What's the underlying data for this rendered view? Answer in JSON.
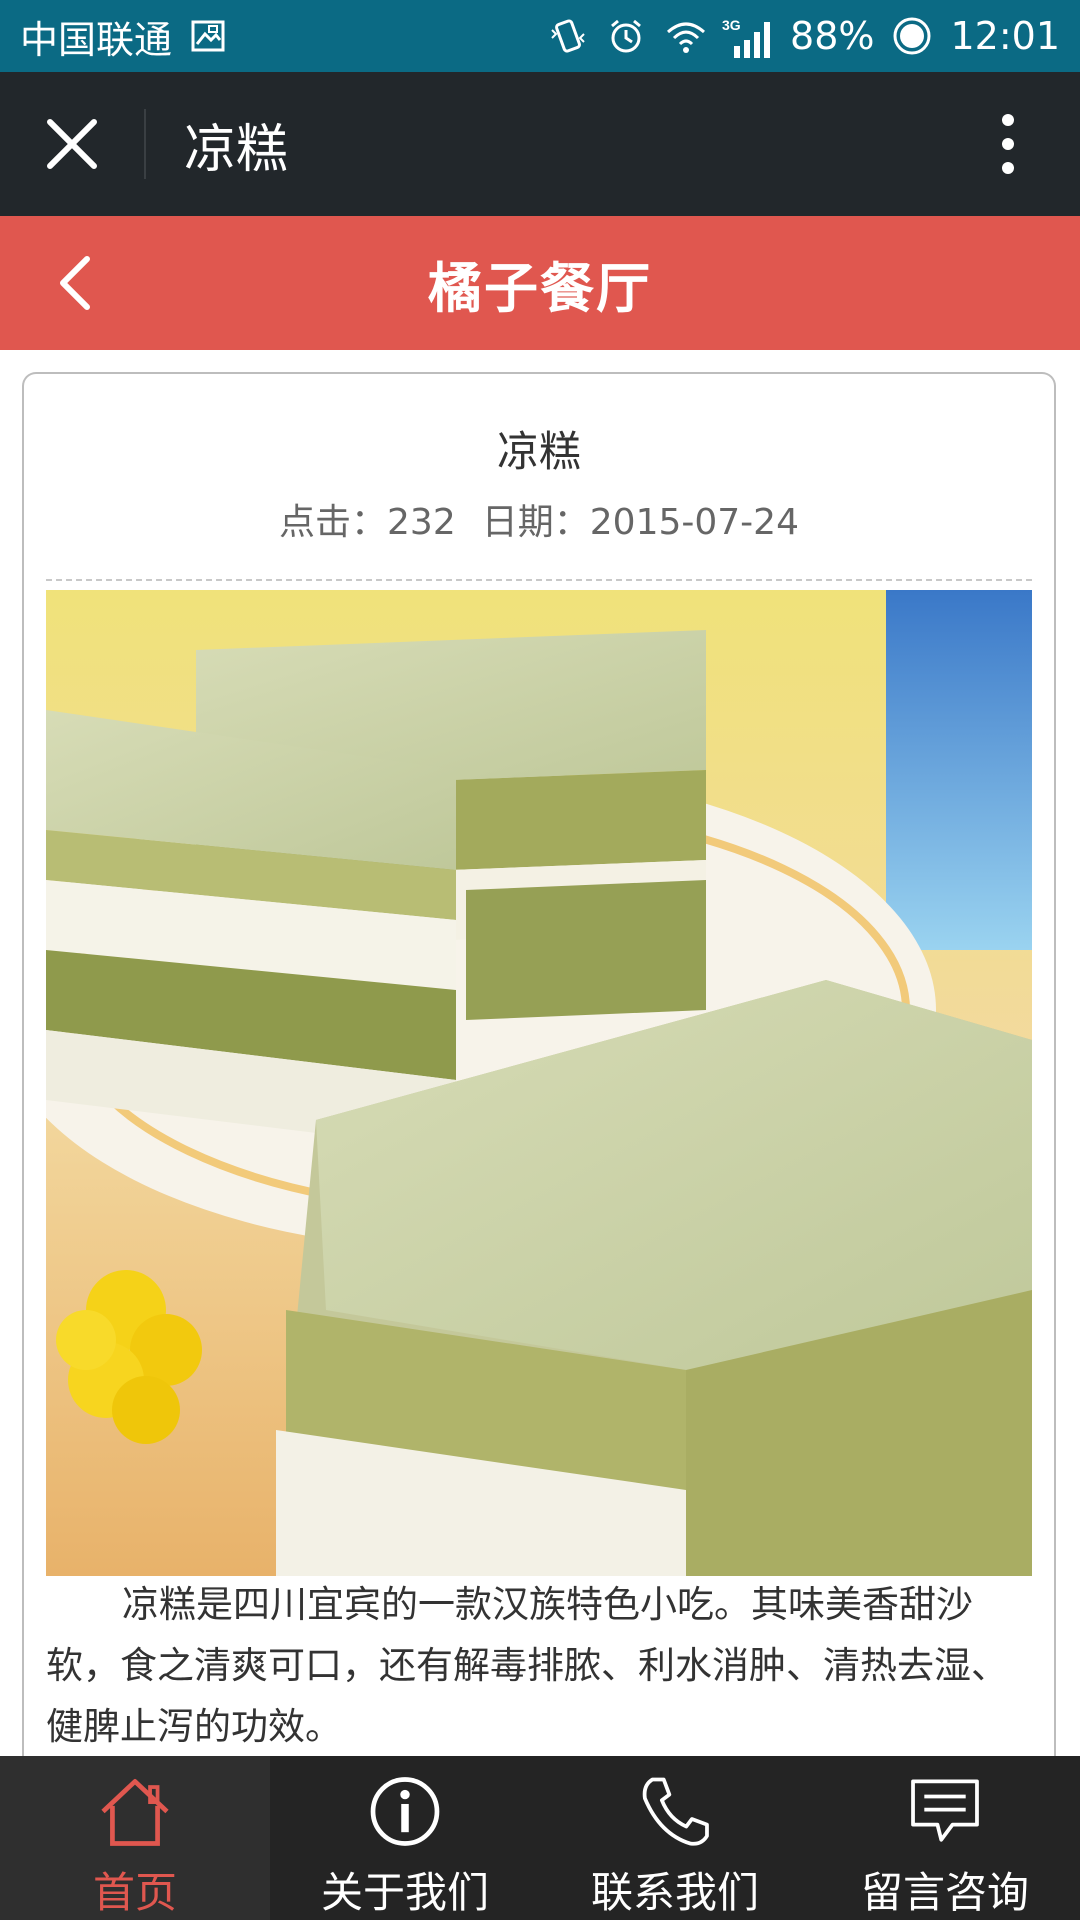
{
  "status_bar": {
    "carrier": "中国联通",
    "network": "3G",
    "battery": "88%",
    "time": "12:01",
    "icons": [
      "image-icon",
      "vibrate-icon",
      "alarm-icon",
      "wifi-icon",
      "signal-icon",
      "battery-icon"
    ]
  },
  "top_bar": {
    "title": "凉糕",
    "close_icon": "close-icon",
    "more_icon": "more-vertical-icon"
  },
  "site_header": {
    "title": "橘子餐厅",
    "back_icon": "chevron-left-icon"
  },
  "article": {
    "title": "凉糕",
    "clicks_label": "点击：",
    "clicks_value": "232",
    "date_label": "日期：",
    "date_value": "2015-07-24",
    "body": "凉糕是四川宜宾的一款汉族特色小吃。其味美香甜沙软，食之清爽可口，还有解毒排脓、利水消肿、清热去湿、健脾止泻的功效。"
  },
  "bottom_nav": {
    "items": [
      {
        "label": "首页",
        "icon": "home-icon",
        "active": true
      },
      {
        "label": "关于我们",
        "icon": "info-icon",
        "active": false
      },
      {
        "label": "联系我们",
        "icon": "phone-icon",
        "active": false
      },
      {
        "label": "留言咨询",
        "icon": "message-icon",
        "active": false
      }
    ]
  },
  "colors": {
    "status_bar": "#0b6a84",
    "top_bar": "#22272b",
    "accent": "#e0574f",
    "nav_bg": "#242424"
  }
}
